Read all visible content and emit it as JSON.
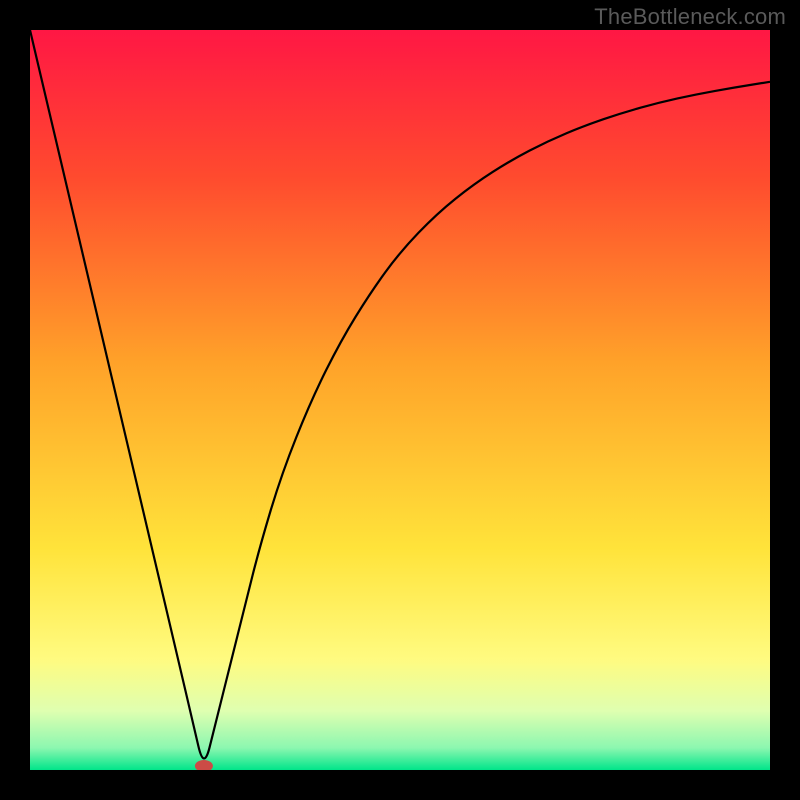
{
  "watermark": "TheBottleneck.com",
  "chart_data": {
    "type": "line",
    "title": "",
    "xlabel": "",
    "ylabel": "",
    "xlim": [
      0,
      100
    ],
    "ylim": [
      0,
      100
    ],
    "grid": false,
    "background_gradient": {
      "stops": [
        {
          "pos": 0.0,
          "color": "#ff1744"
        },
        {
          "pos": 0.2,
          "color": "#ff4b2e"
        },
        {
          "pos": 0.45,
          "color": "#ffa229"
        },
        {
          "pos": 0.7,
          "color": "#ffe33a"
        },
        {
          "pos": 0.85,
          "color": "#fffb80"
        },
        {
          "pos": 0.92,
          "color": "#dfffb0"
        },
        {
          "pos": 0.97,
          "color": "#8cf7b0"
        },
        {
          "pos": 1.0,
          "color": "#00e58a"
        }
      ]
    },
    "series": [
      {
        "name": "bottleneck-curve",
        "color": "#000000",
        "x": [
          0,
          2,
          4,
          6,
          8,
          10,
          12,
          14,
          16,
          18,
          20,
          22,
          23.5,
          25,
          27,
          29,
          31,
          34,
          38,
          42,
          46,
          50,
          55,
          60,
          65,
          70,
          75,
          80,
          85,
          90,
          95,
          100
        ],
        "y": [
          100,
          91.5,
          83,
          74.5,
          66,
          57.5,
          49,
          40.5,
          32,
          23.5,
          15,
          6.5,
          0,
          6,
          14,
          22,
          30,
          40,
          50,
          58,
          64.5,
          70,
          75.2,
          79.2,
          82.4,
          85,
          87.1,
          88.8,
          90.2,
          91.3,
          92.2,
          93
        ]
      }
    ],
    "marker": {
      "name": "min-point",
      "x": 23.5,
      "y": 0,
      "color": "#cc4b46",
      "rx": 9,
      "ry": 6
    }
  }
}
